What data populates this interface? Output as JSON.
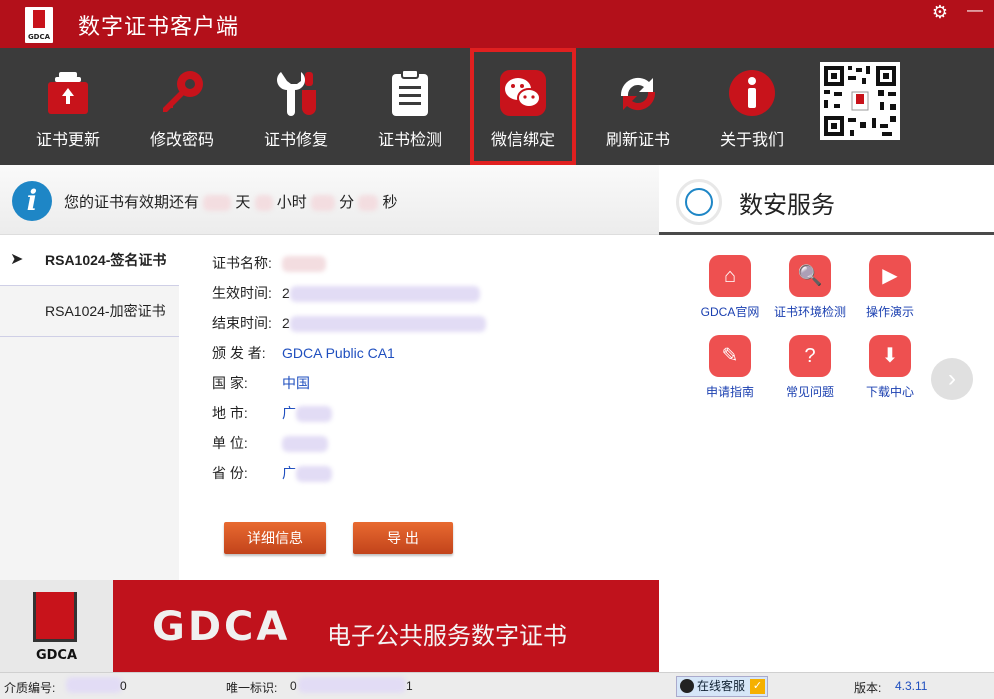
{
  "app": {
    "title": "数字证书客户端",
    "logo_text": "GDCA"
  },
  "window": {
    "gear_glyph": "⚙",
    "minimize_glyph": "—"
  },
  "toolbar": {
    "items": [
      {
        "label": "证书更新",
        "icon": "cert-update-icon"
      },
      {
        "label": "修改密码",
        "icon": "key-icon"
      },
      {
        "label": "证书修复",
        "icon": "wrench-icon"
      },
      {
        "label": "证书检测",
        "icon": "clipboard-icon"
      },
      {
        "label": "微信绑定",
        "icon": "wechat-icon",
        "active": true
      },
      {
        "label": "刷新证书",
        "icon": "refresh-icon"
      },
      {
        "label": "关于我们",
        "icon": "info-icon"
      }
    ],
    "qr_icon": "qr-code-icon"
  },
  "validity": {
    "prefix": "您的证书有效期还有",
    "day": "天",
    "hour": "小时",
    "minute": "分",
    "second": "秒"
  },
  "cert_list": {
    "items": [
      {
        "label": "RSA1024-签名证书",
        "selected": true
      },
      {
        "label": "RSA1024-加密证书",
        "selected": false
      }
    ]
  },
  "details": {
    "name_label": "证书名称:",
    "start_label": "生效时间:",
    "start_prefix": "2",
    "end_label": "结束时间:",
    "end_prefix": "2",
    "issuer_label": "颁 发 者:",
    "issuer_value": "GDCA Public CA1",
    "country_label": "国      家:",
    "country_value": "中国",
    "city_label": "地      市:",
    "city_value": "广",
    "org_label": "单      位:",
    "province_label": "省      份:",
    "province_value": "广",
    "btn_detail": "详细信息",
    "btn_export": "导    出"
  },
  "banner": {
    "logo_text": "GDCA",
    "brand": "GDCA",
    "subtitle": "电子公共服务数字证书"
  },
  "services": {
    "title": "数安服务",
    "items": [
      {
        "label": "GDCA官网",
        "icon": "home-icon"
      },
      {
        "label": "证书环境检测",
        "icon": "doc-search-icon"
      },
      {
        "label": "操作演示",
        "icon": "video-icon"
      },
      {
        "label": "申请指南",
        "icon": "form-icon"
      },
      {
        "label": "常见问题",
        "icon": "question-icon"
      },
      {
        "label": "下载中心",
        "icon": "download-icon"
      }
    ]
  },
  "status": {
    "media_label": "介质编号:",
    "media_value_suffix": "0",
    "uid_label": "唯一标识:",
    "uid_prefix": "0",
    "uid_suffix": "1",
    "service_label": "在线客服",
    "version_label": "版本:",
    "version_value": "4.3.11"
  },
  "colors": {
    "brand_red": "#b3101a",
    "toolbar_bg": "#3b3b3b",
    "link_blue": "#1f4fbf",
    "service_icon": "#ee5050"
  }
}
